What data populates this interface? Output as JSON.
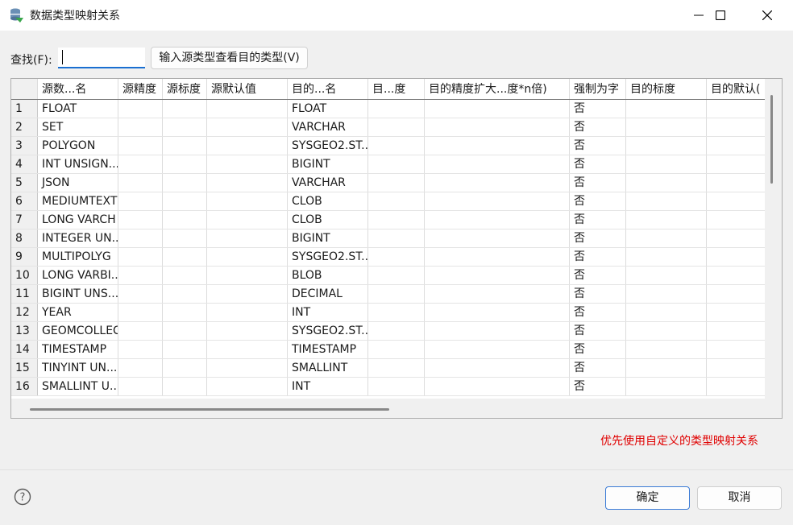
{
  "window": {
    "title": "数据类型映射关系",
    "minimize_icon": "minimize-icon",
    "maximize_icon": "maximize-icon",
    "close_icon": "close-icon"
  },
  "search": {
    "label": "查找(F):",
    "value": "",
    "view_button": "输入源类型查看目的类型(V)"
  },
  "table": {
    "columns": [
      "源数...名",
      "源精度",
      "源标度",
      "源默认值",
      "目的...名",
      "目...度",
      "目的精度扩大...度*n倍)",
      "强制为字",
      "目的标度",
      "目的默认("
    ],
    "rows": [
      {
        "num": "1",
        "src": "FLOAT",
        "dst": "FLOAT",
        "force": "否"
      },
      {
        "num": "2",
        "src": "SET",
        "dst": "VARCHAR",
        "force": "否"
      },
      {
        "num": "3",
        "src": "POLYGON",
        "dst": "SYSGEO2.ST..",
        "force": "否"
      },
      {
        "num": "4",
        "src": "INT UNSIGN...",
        "dst": "BIGINT",
        "force": "否"
      },
      {
        "num": "5",
        "src": "JSON",
        "dst": "VARCHAR",
        "force": "否"
      },
      {
        "num": "6",
        "src": "MEDIUMTEXT",
        "dst": "CLOB",
        "force": "否"
      },
      {
        "num": "7",
        "src": "LONG VARCH",
        "dst": "CLOB",
        "force": "否"
      },
      {
        "num": "8",
        "src": "INTEGER UN...",
        "dst": "BIGINT",
        "force": "否"
      },
      {
        "num": "9",
        "src": "MULTIPOLYG",
        "dst": "SYSGEO2.ST..",
        "force": "否"
      },
      {
        "num": "10",
        "src": "LONG VARBI...",
        "dst": "BLOB",
        "force": "否"
      },
      {
        "num": "11",
        "src": "BIGINT UNS...",
        "dst": "DECIMAL",
        "force": "否"
      },
      {
        "num": "12",
        "src": "YEAR",
        "dst": "INT",
        "force": "否"
      },
      {
        "num": "13",
        "src": "GEOMCOLLEC",
        "dst": "SYSGEO2.ST..",
        "force": "否"
      },
      {
        "num": "14",
        "src": "TIMESTAMP",
        "dst": "TIMESTAMP",
        "force": "否"
      },
      {
        "num": "15",
        "src": "TINYINT UN...",
        "dst": "SMALLINT",
        "force": "否"
      },
      {
        "num": "16",
        "src": "SMALLINT U...",
        "dst": "INT",
        "force": "否"
      }
    ]
  },
  "note": "优先使用自定义的类型映射关系",
  "footer": {
    "help_icon": "help-icon",
    "ok": "确定",
    "cancel": "取消"
  },
  "colors": {
    "accent": "#1a6fd1",
    "note": "#e00000"
  }
}
